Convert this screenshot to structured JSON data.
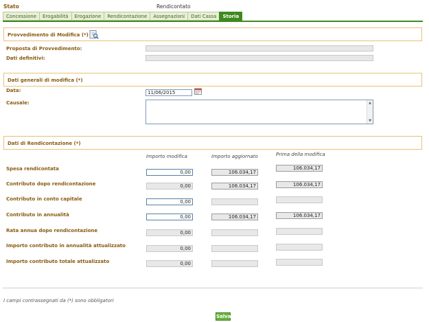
{
  "header": {
    "status_label": "Stato",
    "status_value": "Rendicontato"
  },
  "tabs": [
    {
      "label": "Concessione"
    },
    {
      "label": "Erogabilità"
    },
    {
      "label": "Erogazione"
    },
    {
      "label": "Rendicontazione"
    },
    {
      "label": "Assegnazioni"
    },
    {
      "label": "Dati Cassa"
    },
    {
      "label": "Storia"
    }
  ],
  "active_tab": "Storia",
  "provvedimento": {
    "title": "Provvedimento di Modifica (*)",
    "icon": "document-search-icon",
    "proposta_label": "Proposta di Provvedimento:",
    "proposta_value": "",
    "dati_definitivi_label": "Dati definitivi:",
    "dati_definitivi_value": ""
  },
  "dati_generali": {
    "title": "Dati generali di modifica (*)",
    "data_label": "Data:",
    "data_value": "11/06/2015",
    "causale_label": "Causale:",
    "causale_value": ""
  },
  "rendicontazione": {
    "title": "Dati di Rendicontazione (*)",
    "columns": [
      "Importo modifica",
      "Importo aggiornato",
      "Prima della modifica"
    ],
    "rows": [
      {
        "label": "Spesa rendicontata",
        "modifica": "0,00",
        "aggiornato": "106.034,17",
        "prima": "106.034,17"
      },
      {
        "label": "Contributo dopo rendicontazione",
        "modifica": "0,00",
        "aggiornato": "106.034,17",
        "prima": "106.034,17"
      },
      {
        "label": "Contributo in conto capitale",
        "modifica": "0,00",
        "aggiornato": "",
        "prima": ""
      },
      {
        "label": "Contributo in annualità",
        "modifica": "0,00",
        "aggiornato": "106.034,17",
        "prima": "106.034,17"
      },
      {
        "label": "Rata annua dopo rendicontazione",
        "modifica": "0,00",
        "aggiornato": "",
        "prima": ""
      },
      {
        "label": "Importo contributo in annualità attualizzato",
        "modifica": "0,00",
        "aggiornato": "",
        "prima": ""
      },
      {
        "label": "Importo contributo totale attualizzato",
        "modifica": "0,00",
        "aggiornato": "",
        "prima": ""
      }
    ]
  },
  "footnote": "I campi contrassegnati da (*) sono obbligatori",
  "save_label": "Salva",
  "colors": {
    "accent_green": "#3e8a1f",
    "label_brown": "#8a5a10",
    "section_border": "#e8c078"
  }
}
